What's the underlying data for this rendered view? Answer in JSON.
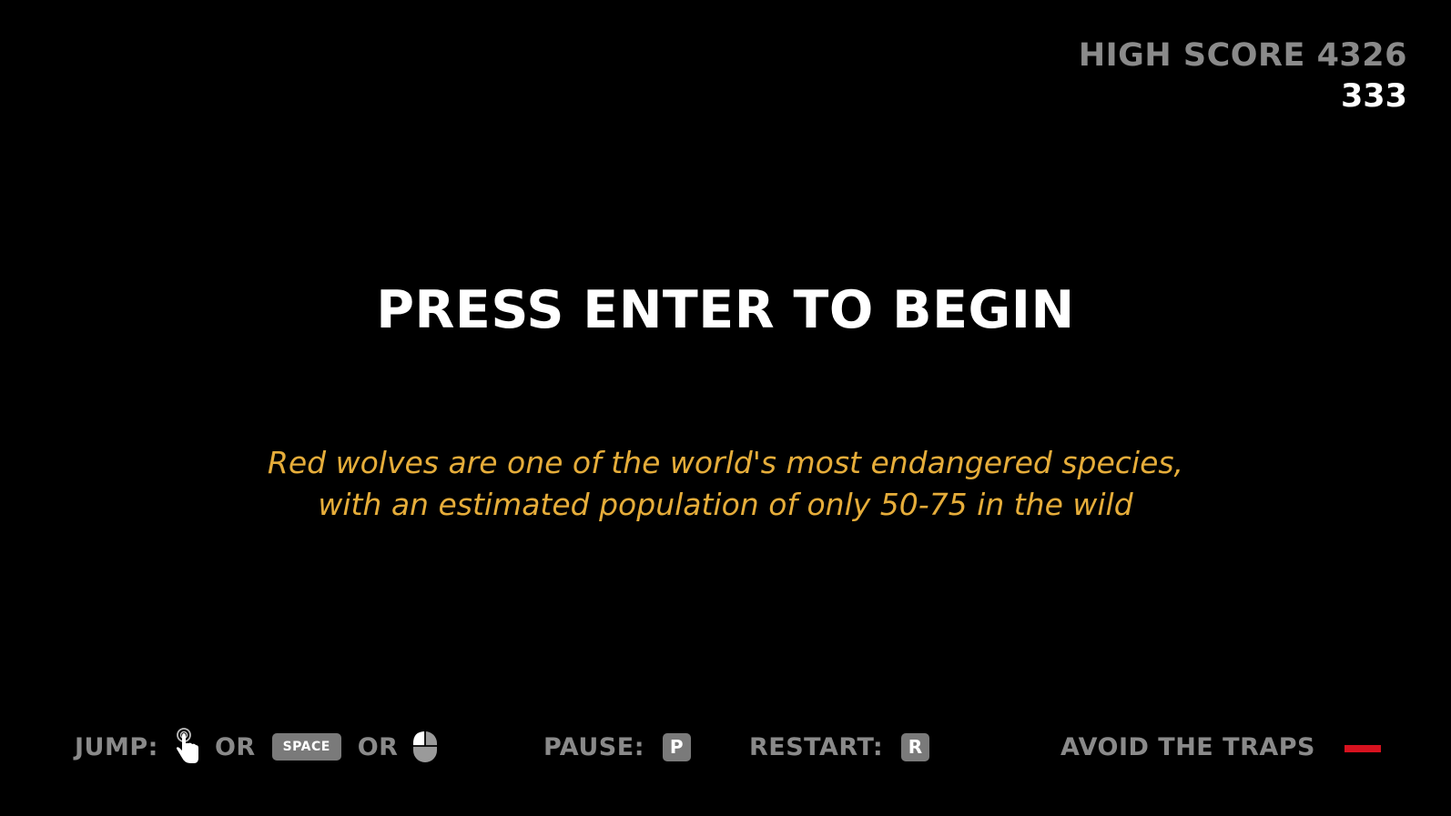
{
  "hud": {
    "high_score_label": "HIGH SCORE",
    "high_score_value": "4326",
    "current_score": "333"
  },
  "title": "PRESS ENTER TO BEGIN",
  "fact": {
    "line1": "Red wolves are one of the world's most endangered species,",
    "line2": "with an estimated population of only 50-75 in the wild"
  },
  "controls": {
    "jump_label": "JUMP:",
    "or_1": "OR",
    "space_key": "SPACE",
    "or_2": "OR",
    "pause_label": "PAUSE:",
    "pause_key": "P",
    "restart_label": "RESTART:",
    "restart_key": "R",
    "avoid_label": "AVOID THE TRAPS"
  },
  "icons": {
    "tap": "hand-tap-icon",
    "mouse": "mouse-left-click-icon",
    "trap": "trap-icon"
  },
  "colors": {
    "background": "#000000",
    "title": "#ffffff",
    "fact": "#e6ad3a",
    "muted": "#8a8a8a",
    "key": "#7a7a7a",
    "trap": "#d7121f"
  }
}
